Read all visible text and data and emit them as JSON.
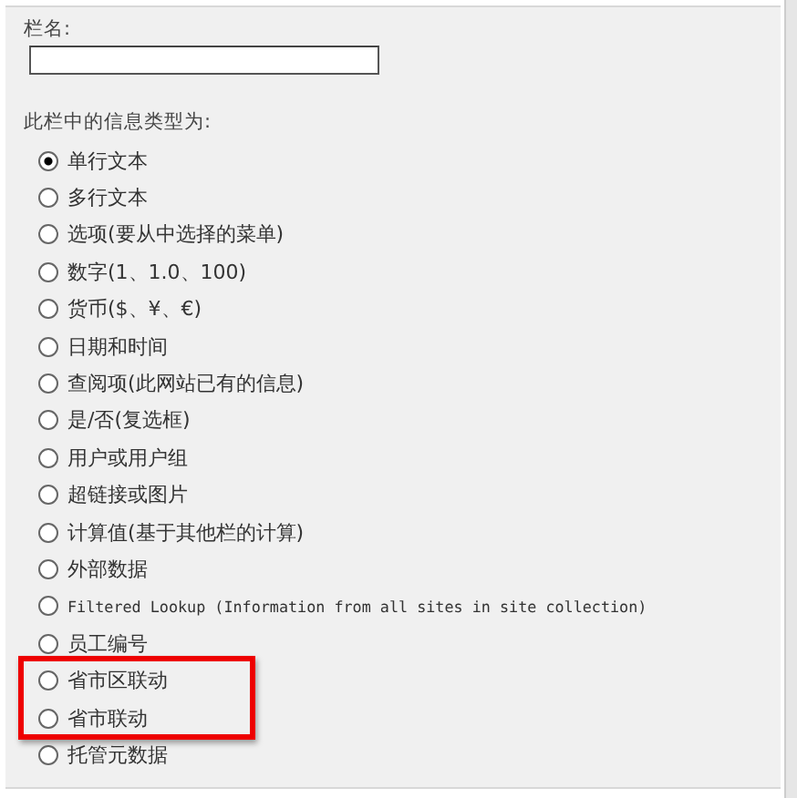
{
  "field": {
    "label": "栏名:"
  },
  "type_label": "此栏中的信息类型为:",
  "options": [
    {
      "label": "单行文本",
      "kind": "cjk",
      "selected": true,
      "highlighted": false
    },
    {
      "label": "多行文本",
      "kind": "cjk",
      "selected": false,
      "highlighted": false
    },
    {
      "label": "选项(要从中选择的菜单)",
      "kind": "cjk",
      "selected": false,
      "highlighted": false
    },
    {
      "label": "数字(1、1.0、100)",
      "kind": "cjk",
      "selected": false,
      "highlighted": false
    },
    {
      "label": "货币($、¥、€)",
      "kind": "cjk",
      "selected": false,
      "highlighted": false
    },
    {
      "label": "日期和时间",
      "kind": "cjk",
      "selected": false,
      "highlighted": false
    },
    {
      "label": "查阅项(此网站已有的信息)",
      "kind": "cjk",
      "selected": false,
      "highlighted": false
    },
    {
      "label": "是/否(复选框)",
      "kind": "cjk",
      "selected": false,
      "highlighted": false
    },
    {
      "label": "用户或用户组",
      "kind": "cjk",
      "selected": false,
      "highlighted": false
    },
    {
      "label": "超链接或图片",
      "kind": "cjk",
      "selected": false,
      "highlighted": false
    },
    {
      "label": "计算值(基于其他栏的计算)",
      "kind": "cjk",
      "selected": false,
      "highlighted": false
    },
    {
      "label": "外部数据",
      "kind": "cjk",
      "selected": false,
      "highlighted": false
    },
    {
      "label": "Filtered Lookup (Information from all sites in site collection)",
      "kind": "latin",
      "selected": false,
      "highlighted": false
    },
    {
      "label": "员工编号",
      "kind": "cjk",
      "selected": false,
      "highlighted": false
    },
    {
      "label": "省市区联动",
      "kind": "cjk",
      "selected": false,
      "highlighted": true
    },
    {
      "label": "省市联动",
      "kind": "cjk",
      "selected": false,
      "highlighted": true
    },
    {
      "label": "托管元数据",
      "kind": "cjk",
      "selected": false,
      "highlighted": false
    }
  ]
}
